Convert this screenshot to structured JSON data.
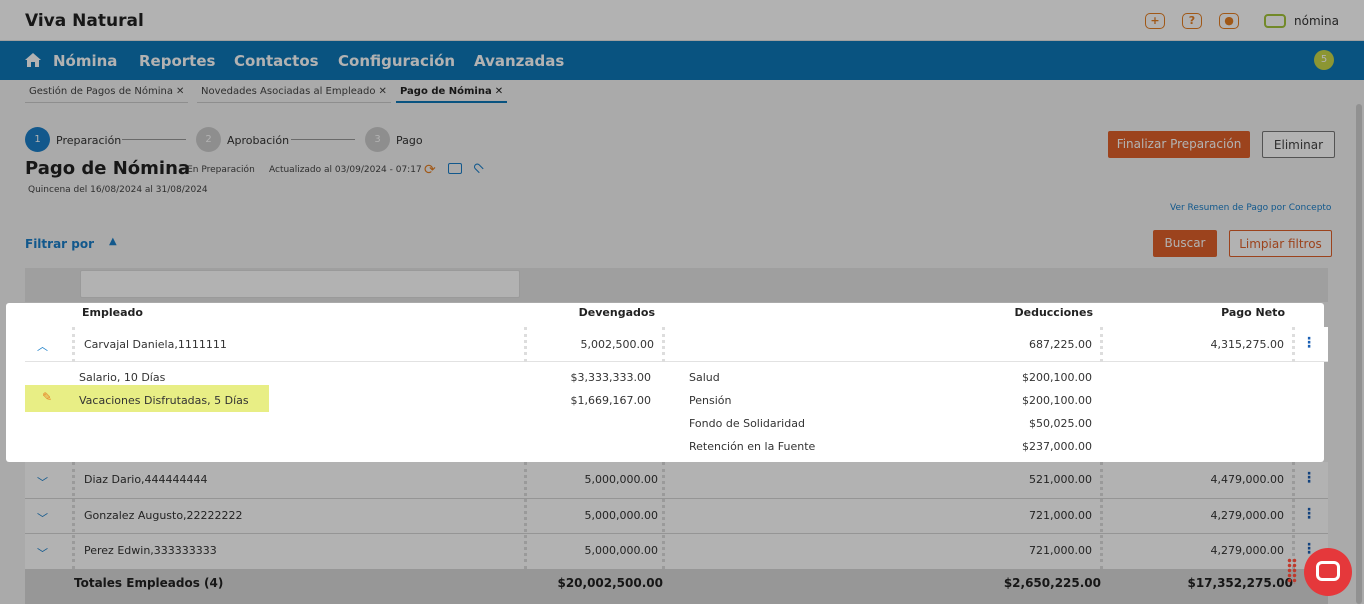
{
  "app": {
    "brand": "Viva Natural",
    "logo_text": "nómina",
    "icons": [
      "plus-icon",
      "help-icon",
      "user-icon"
    ]
  },
  "nav": {
    "items": [
      "Nómina",
      "Reportes",
      "Contactos",
      "Configuración",
      "Avanzadas"
    ],
    "badge": "5",
    "home_icon": "home-icon"
  },
  "tabs": [
    {
      "label": "Gestión de Pagos de Nómina"
    },
    {
      "label": "Novedades Asociadas al Empleado"
    },
    {
      "label": "Pago de Nómina"
    }
  ],
  "steps": [
    {
      "num": "1",
      "label": "Preparación"
    },
    {
      "num": "2",
      "label": "Aprobación"
    },
    {
      "num": "3",
      "label": "Pago"
    }
  ],
  "header": {
    "title": "Pago de Nómina",
    "status": "- En Preparación",
    "updated": "Actualizado al 03/09/2024 - 07:17",
    "period": "Quincena del 16/08/2024 al 31/08/2024"
  },
  "actions": {
    "finalize": "Finalizar Preparación",
    "delete": "Eliminar",
    "summary_link": "Ver Resumen de Pago por Concepto",
    "search": "Buscar",
    "clear": "Limpiar filtros"
  },
  "filter": {
    "label": "Filtrar por"
  },
  "table": {
    "headers": {
      "employee": "Empleado",
      "earned": "Devengados",
      "deductions": "Deducciones",
      "net": "Pago Neto"
    },
    "expanded": {
      "name": "Carvajal Daniela,1111111",
      "earned": "5,002,500.00",
      "deductions": "687,225.00",
      "net": "4,315,275.00",
      "earnings": [
        {
          "label": "Salario, 10 Días",
          "value": "$3,333,333.00"
        },
        {
          "label": "Vacaciones Disfrutadas, 5 Días",
          "value": "$1,669,167.00"
        }
      ],
      "deduction_items": [
        {
          "label": "Salud",
          "value": "$200,100.00"
        },
        {
          "label": "Pensión",
          "value": "$200,100.00"
        },
        {
          "label": "Fondo de Solidaridad",
          "value": "$50,025.00"
        },
        {
          "label": "Retención en la Fuente",
          "value": "$237,000.00"
        }
      ]
    },
    "rows": [
      {
        "name": "Diaz Dario,444444444",
        "earned": "5,000,000.00",
        "deductions": "521,000.00",
        "net": "4,479,000.00"
      },
      {
        "name": "Gonzalez Augusto,22222222",
        "earned": "5,000,000.00",
        "deductions": "721,000.00",
        "net": "4,279,000.00"
      },
      {
        "name": "Perez Edwin,333333333",
        "earned": "5,000,000.00",
        "deductions": "721,000.00",
        "net": "4,279,000.00"
      }
    ],
    "totals": {
      "label": "Totales Empleados (4)",
      "earned": "$20,002,500.00",
      "deductions": "$2,650,225.00",
      "net": "$17,352,275.00"
    }
  },
  "colors": {
    "nav": "#0e78b8",
    "accent": "#e0612a",
    "link": "#1a7fc9",
    "highlight": "#e8ee85"
  }
}
